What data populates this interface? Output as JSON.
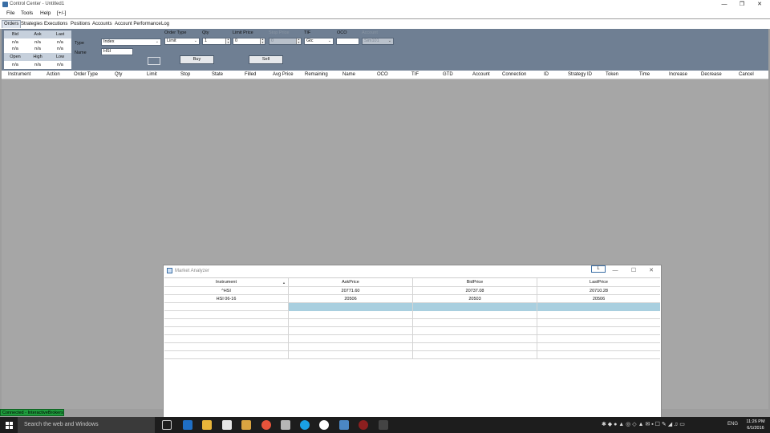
{
  "window": {
    "title": "Control Center - Untitled1",
    "minimize": "—",
    "restore": "❐",
    "close": "✕"
  },
  "menu": [
    "File",
    "Tools",
    "Help",
    "[+/-]"
  ],
  "tabs": [
    "Orders",
    "Strategies",
    "Executions",
    "Positions",
    "Accounts",
    "Account Performance",
    "Log"
  ],
  "order_entry": {
    "quote_headers": [
      "Bid",
      "Ask",
      "Last"
    ],
    "quote_row1": [
      "n/a",
      "n/a",
      "n/a"
    ],
    "quote_row2": [
      "n/a",
      "n/a",
      "n/a"
    ],
    "quote_headers2": [
      "Open",
      "High",
      "Low"
    ],
    "quote_row3": [
      "n/a",
      "n/a",
      "n/a"
    ],
    "type_label": "Type",
    "type_value": "Index",
    "name_label": "Name",
    "name_value": "HSI",
    "order_type_label": "Order Type",
    "order_type_value": "Limit",
    "qty_label": "Qty",
    "qty_value": "1",
    "limit_price_label": "Limit Price",
    "limit_price_value": "0",
    "stop_price_label": "Stop Price",
    "stop_price_value": "0",
    "tif_label": "TIF",
    "tif_value": "Gtc",
    "oco_label": "OCO",
    "oco_value": "",
    "account_label": "Account",
    "account_value": "Sim101",
    "buy_label": "Buy",
    "sell_label": "Sell"
  },
  "orders_grid": {
    "columns": [
      "Instrument",
      "Action",
      "Order Type",
      "Qty",
      "Limit",
      "Stop",
      "State",
      "Filled",
      "Avg Price",
      "Remaining",
      "Name",
      "OCO",
      "TIF",
      "GTD",
      "Account",
      "Connection",
      "ID",
      "Strategy ID",
      "Token",
      "Time",
      "Increase",
      "Decrease",
      "Cancel"
    ]
  },
  "market_analyzer": {
    "title": "Market Analyzer",
    "pin_label": "L",
    "columns": [
      "Instrument",
      "AskPrice",
      "BidPrice",
      "LastPrice"
    ],
    "rows": [
      [
        "^HSI",
        "20771.60",
        "20737.08",
        "20710.28"
      ],
      [
        "HSI 06-16",
        "20506",
        "20503",
        "20506"
      ]
    ]
  },
  "status_bar": "Connected - InteractiveBrokers",
  "taskbar": {
    "search_placeholder": "Search the web and Windows",
    "language": "ENG",
    "time": "11:26 PM",
    "date": "6/1/2016"
  }
}
